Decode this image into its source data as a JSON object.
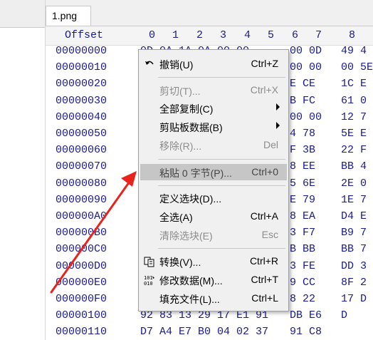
{
  "tab": {
    "title": "1.png"
  },
  "hex_header": {
    "offset_label": "Offset",
    "columns": [
      "0",
      "1",
      "2",
      "3",
      "4",
      "5",
      "6",
      "7",
      "8"
    ]
  },
  "rows": [
    {
      "offset": "00000000",
      "left": "0D 0A 1A 0A 00 00",
      "mid": "00 0D",
      "right": "49 4"
    },
    {
      "offset": "00000010",
      "left": "",
      "mid": "00 00",
      "right": "00 5E"
    },
    {
      "offset": "00000020",
      "left": "",
      "mid": "E CE",
      "right": "1C E"
    },
    {
      "offset": "00000030",
      "left": "",
      "mid": "B FC",
      "right": "61 0"
    },
    {
      "offset": "00000040",
      "left": "",
      "mid": "00 00",
      "right": "12 7"
    },
    {
      "offset": "00000050",
      "left": "",
      "mid": "4 78",
      "right": "5E E"
    },
    {
      "offset": "00000060",
      "left": "",
      "mid": "F 3B",
      "right": "22 F"
    },
    {
      "offset": "00000070",
      "left": "",
      "mid": "8 EE",
      "right": "BB 4"
    },
    {
      "offset": "00000080",
      "left": "",
      "mid": "5 6E",
      "right": "2E 0"
    },
    {
      "offset": "00000090",
      "left": "",
      "mid": "E 79",
      "right": "1E 7"
    },
    {
      "offset": "000000A0",
      "left": "",
      "mid": "8 EA",
      "right": "D4 E"
    },
    {
      "offset": "000000B0",
      "left": "",
      "mid": "3 F7",
      "right": "B9 7"
    },
    {
      "offset": "000000C0",
      "left": "",
      "mid": "B BB",
      "right": "BB 7"
    },
    {
      "offset": "000000D0",
      "left": "",
      "mid": "3 FE",
      "right": "DD 3"
    },
    {
      "offset": "000000E0",
      "left": "",
      "mid": "9 CC",
      "right": "8F 2"
    },
    {
      "offset": "000000F0",
      "left": "",
      "mid": "8 22",
      "right": "17 D"
    },
    {
      "offset": "00000100",
      "left": "92 83 13 29 17 E1 91",
      "mid": "DB E6",
      "right": "D"
    },
    {
      "offset": "00000110",
      "left": "D7 A4 E7 B0 04 02 37",
      "mid": "91 C8",
      "right": ""
    }
  ],
  "context_menu": {
    "items": [
      {
        "name": "undo",
        "label": "撤销(U)",
        "shortcut": "Ctrl+Z",
        "icon": "undo-icon",
        "disabled": false
      },
      {
        "name": "cut",
        "label": "剪切(T)...",
        "shortcut": "Ctrl+X",
        "disabled": true
      },
      {
        "name": "copy-all",
        "label": "全部复制(C)",
        "submenu": true,
        "disabled": false
      },
      {
        "name": "clipboard-data",
        "label": "剪贴板数据(B)",
        "submenu": true,
        "disabled": false
      },
      {
        "name": "remove",
        "label": "移除(R)...",
        "shortcut": "Del",
        "disabled": true
      },
      {
        "name": "paste",
        "label": "粘贴 0 字节(P)...",
        "shortcut": "Ctrl+0",
        "disabled": true,
        "highlighted": true
      },
      {
        "name": "define-block",
        "label": "定义选块(D)...",
        "disabled": false
      },
      {
        "name": "select-all",
        "label": "全选(A)",
        "shortcut": "Ctrl+A",
        "disabled": false
      },
      {
        "name": "clear-block",
        "label": "清除选块(E)",
        "shortcut": "Esc",
        "disabled": true
      },
      {
        "name": "convert",
        "label": "转换(V)...",
        "shortcut": "Ctrl+R",
        "icon": "convert-icon",
        "disabled": false
      },
      {
        "name": "modify-data",
        "label": "修改数据(M)...",
        "shortcut": "Ctrl+T",
        "icon": "binary-icon",
        "disabled": false
      },
      {
        "name": "fill-file",
        "label": "填充文件(L)...",
        "shortcut": "Ctrl+L",
        "disabled": false
      }
    ]
  },
  "colors": {
    "hex_text": "#1a1a8a",
    "arrow": "#e8231c",
    "menu_bg": "#f0f0f0",
    "highlight": "#c6c6c6"
  }
}
